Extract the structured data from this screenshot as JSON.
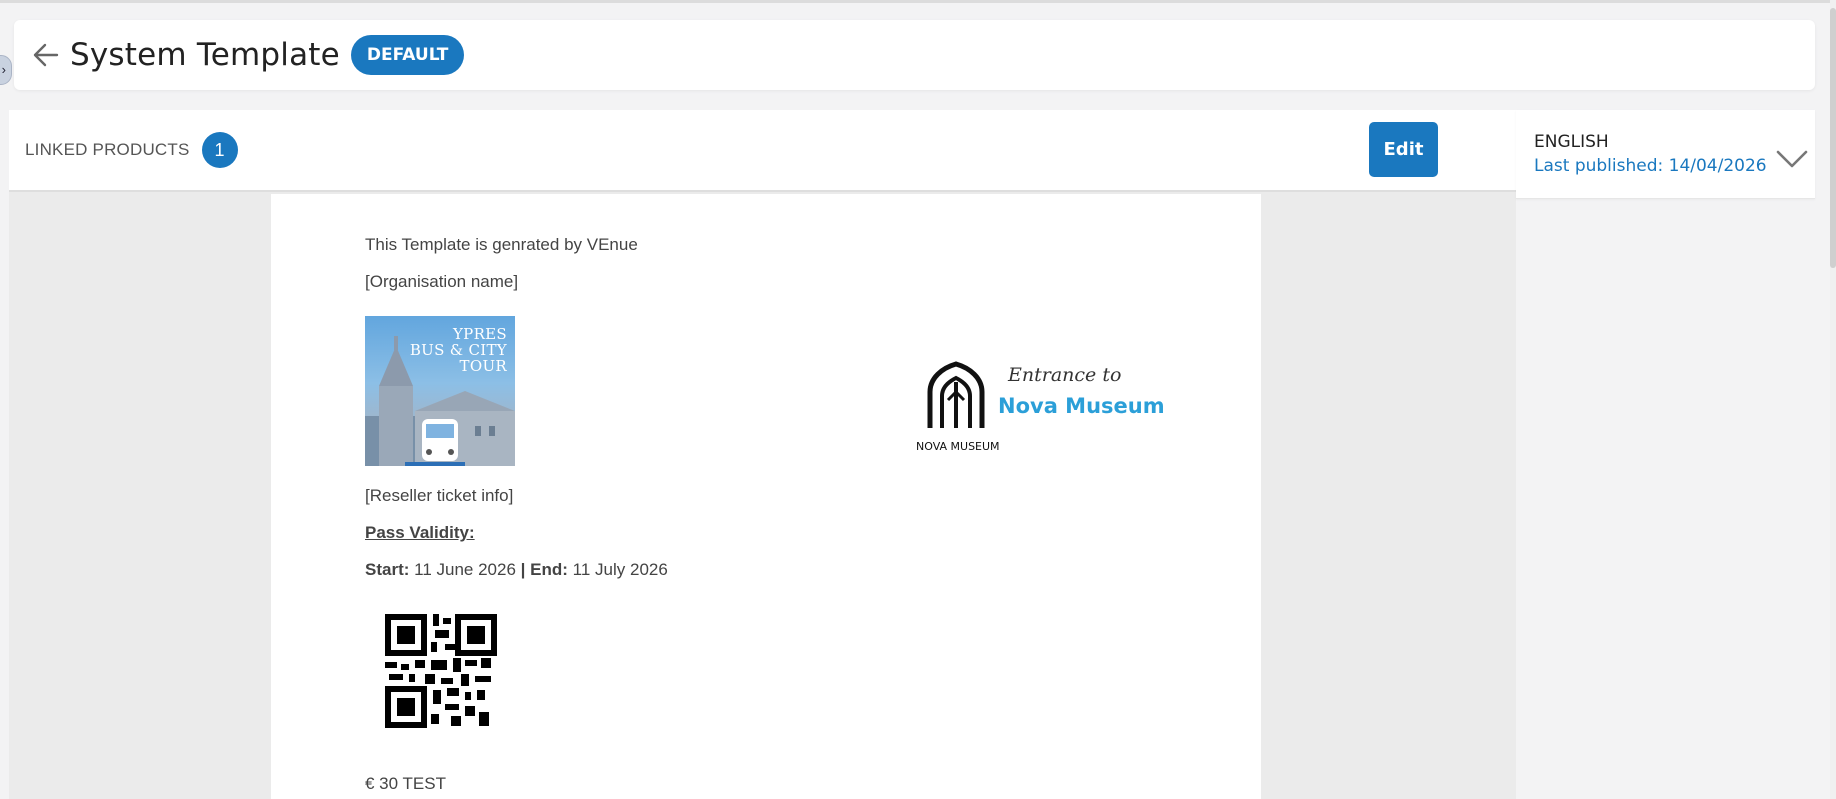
{
  "header": {
    "title": "System Template",
    "badge": "DEFAULT"
  },
  "linked_products": {
    "label": "LINKED PRODUCTS",
    "count": "1",
    "edit_label": "Edit"
  },
  "language": {
    "name": "ENGLISH",
    "published": "Last published: 14/04/2026"
  },
  "document": {
    "intro": "This Template is genrated by VEnue",
    "org_placeholder": "[Organisation name]",
    "tour_image_text": [
      "YPRES",
      "BUS & CITY",
      "TOUR"
    ],
    "logo": {
      "line1": "Entrance to",
      "line2": "Nova Museum",
      "caption": "NOVA MUSEUM"
    },
    "reseller_placeholder": "[Reseller ticket info]",
    "pass_validity": "Pass Validity:",
    "start_label": "Start:",
    "start_value": "11 June 2026",
    "separator": "|",
    "end_label": "End:",
    "end_value": "11 July 2026",
    "price": "€ 30 TEST"
  },
  "colors": {
    "accent": "#1a78bf",
    "logo_blue": "#2b9fd8"
  },
  "icons": {
    "back": "arrow-left-icon",
    "language_toggle": "chevron-down-icon"
  }
}
